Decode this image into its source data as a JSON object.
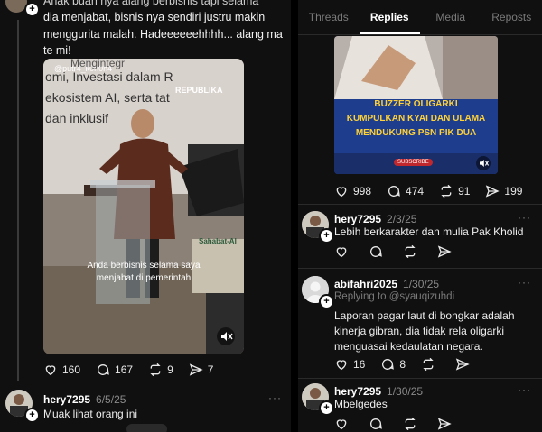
{
  "left": {
    "post_text_top": "Anak buah nya alang berbisnis tapi selama",
    "post_text": "dia menjabat, bisnis nya sendiri justru makin menggurita malah. Hadeeeeeehhhh... alang ma te mi!",
    "video": {
      "handle": "@putr4_k0n0h4",
      "slide_line1": "omi, Investasi dalam R",
      "slide_line2": "ekosistem AI, serta tat",
      "slide_line3": "dan inklusif",
      "slide_top": "Mengintegr",
      "brand": "REPUBLIKA",
      "podium_logo": "Sahabat-AI",
      "subtitle_line1": "Anda berbisnis selama saya",
      "subtitle_line2": "menjabat di pemerintah"
    },
    "actions": {
      "likes": "160",
      "comments": "167",
      "reposts": "9",
      "shares": "7"
    },
    "comment": {
      "username": "hery7295",
      "date": "6/5/25",
      "text": "Muak lihat orang ini"
    }
  },
  "right": {
    "tabs": [
      "Threads",
      "Replies",
      "Media",
      "Reposts"
    ],
    "active_tab": "Replies",
    "image": {
      "title_line1": "BUZZER OLIGARKI",
      "title_line2": "KUMPULKAN KYAI DAN ULAMA",
      "title_line3": "MENDUKUNG PSN PIK DUA",
      "subscribe": "SUBSCRIBE"
    },
    "image_actions": {
      "likes": "998",
      "comments": "474",
      "reposts": "91",
      "shares": "199"
    },
    "replies": [
      {
        "username": "hery7295",
        "date": "2/3/25",
        "replying_to": "",
        "text": "Lebih berkarakter dan mulia Pak Kholid",
        "likes": "",
        "comments": ""
      },
      {
        "username": "abifahri2025",
        "date": "1/30/25",
        "replying_to": "Replying to @syauqizuhdi",
        "text": "Laporan pagar laut di bongkar adalah kinerja gibran, dia tidak rela oligarki menguasai kedaulatan negara.",
        "likes": "16",
        "comments": "8"
      },
      {
        "username": "hery7295",
        "date": "1/30/25",
        "replying_to": "",
        "text": "Mbelgedes",
        "likes": "",
        "comments": ""
      }
    ],
    "more_label": "···"
  }
}
